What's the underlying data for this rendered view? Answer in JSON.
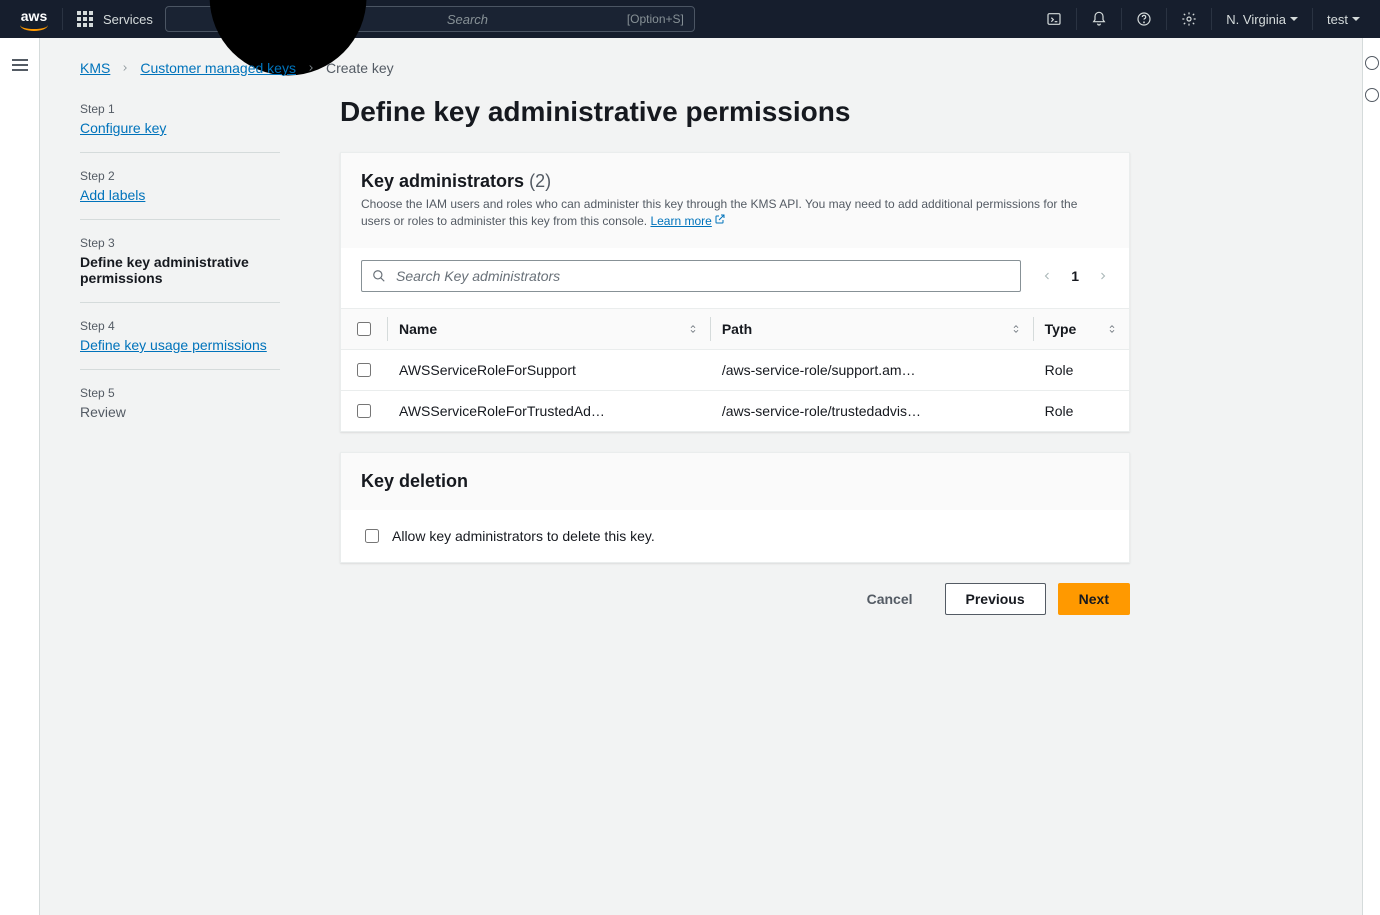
{
  "topnav": {
    "services_label": "Services",
    "search_placeholder": "Search",
    "search_shortcut": "[Option+S]",
    "region": "N. Virginia",
    "account": "test"
  },
  "breadcrumbs": {
    "root": "KMS",
    "mid": "Customer managed keys",
    "current": "Create key"
  },
  "wizard": {
    "steps": [
      {
        "label": "Step 1",
        "title": "Configure key",
        "state": "link"
      },
      {
        "label": "Step 2",
        "title": "Add labels",
        "state": "link"
      },
      {
        "label": "Step 3",
        "title": "Define key administrative permissions",
        "state": "current"
      },
      {
        "label": "Step 4",
        "title": "Define key usage permissions",
        "state": "link"
      },
      {
        "label": "Step 5",
        "title": "Review",
        "state": "disabled"
      }
    ]
  },
  "page": {
    "title": "Define key administrative permissions"
  },
  "key_admins": {
    "heading": "Key administrators",
    "count": "(2)",
    "description": "Choose the IAM users and roles who can administer this key through the KMS API. You may need to add additional permissions for the users or roles to administer this key from this console. ",
    "learn_more": "Learn more",
    "search_placeholder": "Search Key administrators",
    "pagination_page": "1",
    "columns": {
      "name": "Name",
      "path": "Path",
      "type": "Type"
    },
    "rows": [
      {
        "name": "AWSServiceRoleForSupport",
        "path": "/aws-service-role/support.am…",
        "type": "Role"
      },
      {
        "name": "AWSServiceRoleForTrustedAd…",
        "path": "/aws-service-role/trustedadvis…",
        "type": "Role"
      }
    ]
  },
  "key_deletion": {
    "heading": "Key deletion",
    "checkbox_label": "Allow key administrators to delete this key."
  },
  "buttons": {
    "cancel": "Cancel",
    "previous": "Previous",
    "next": "Next"
  }
}
